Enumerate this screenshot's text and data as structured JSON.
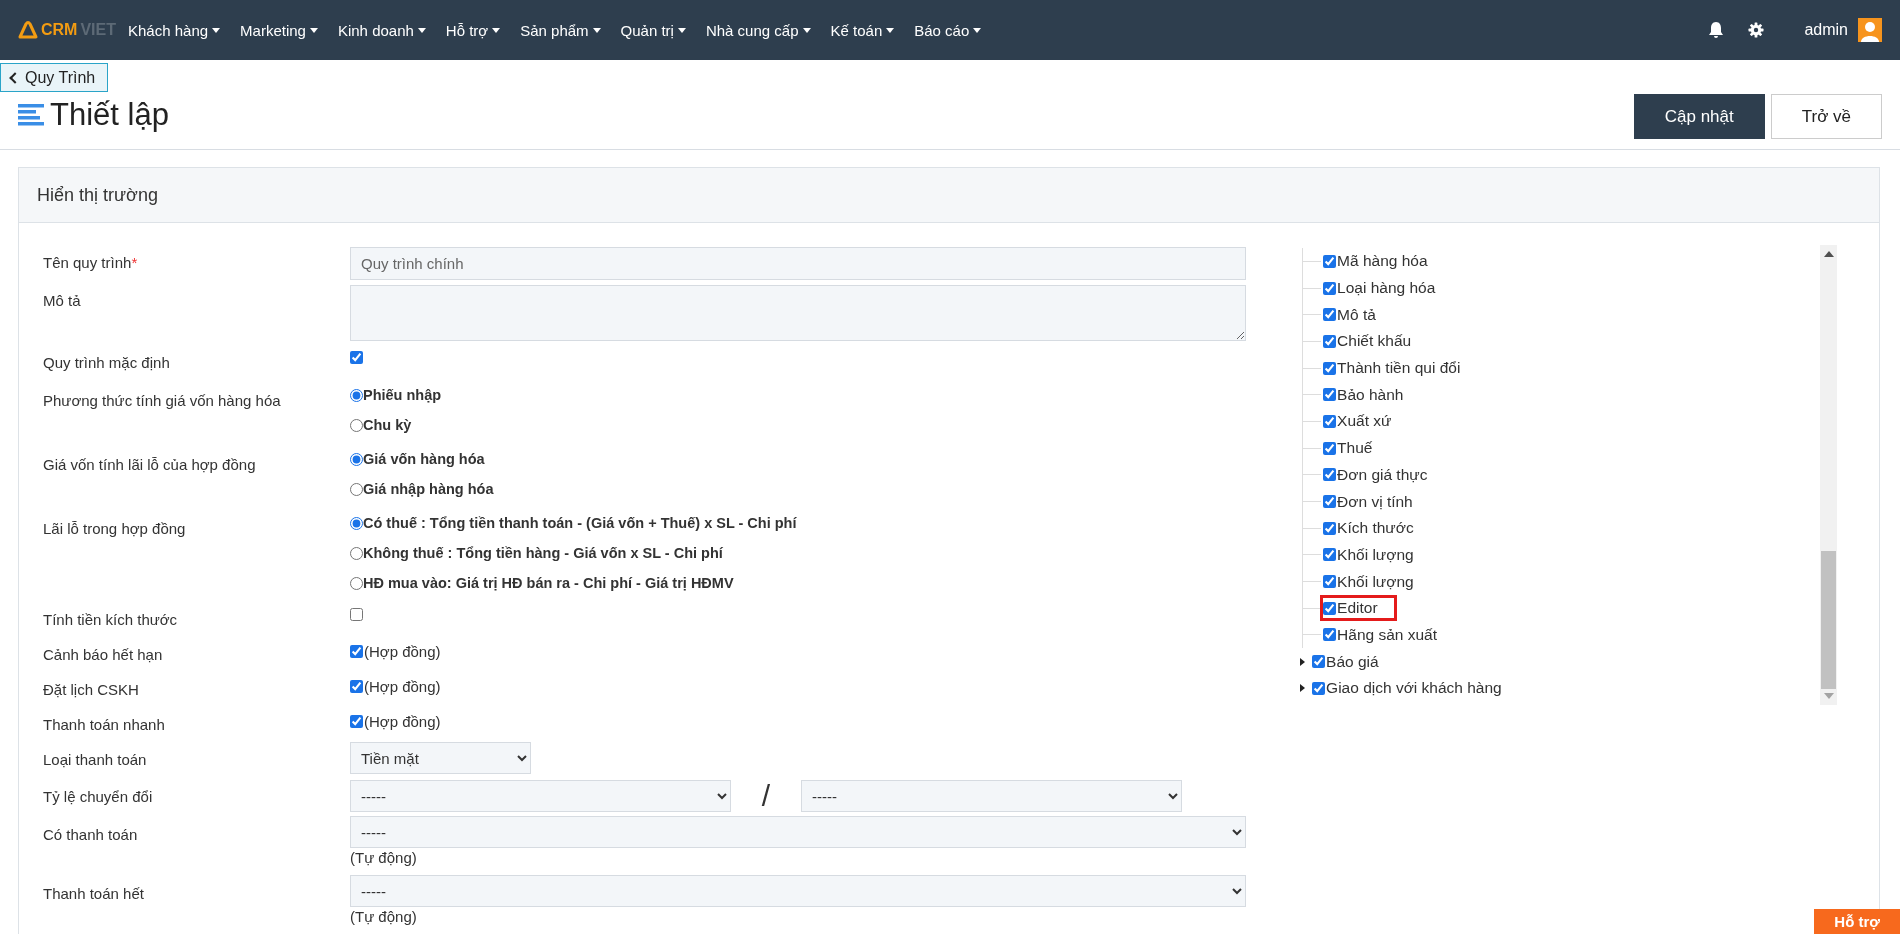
{
  "nav": {
    "logo_primary": "CRM",
    "logo_secondary": "VIET",
    "menu": [
      {
        "label": "Khách hàng"
      },
      {
        "label": "Marketing"
      },
      {
        "label": "Kinh doanh"
      },
      {
        "label": "Hỗ trợ"
      },
      {
        "label": "Sản phẩm"
      },
      {
        "label": "Quản trị"
      },
      {
        "label": "Nhà cung cấp"
      },
      {
        "label": "Kế toán"
      },
      {
        "label": "Báo cáo"
      }
    ],
    "user": "admin"
  },
  "breadcrumb": "Quy Trình",
  "page_title": "Thiết lập",
  "actions": [
    {
      "label": "Cập nhật",
      "kind": "primary"
    },
    {
      "label": "Trở về",
      "kind": "default"
    }
  ],
  "panel": {
    "title": "Hiển thị trường"
  },
  "form": [
    {
      "kind": "text",
      "label": "Tên quy trình",
      "required_mark": "*",
      "value": "Quy trình chính"
    },
    {
      "kind": "textarea",
      "label": "Mô tả"
    },
    {
      "kind": "checkbox",
      "label": "Quy trình mặc định",
      "checked": true
    },
    {
      "kind": "radio",
      "label": "Phương thức tính giá vốn hàng hóa",
      "options": [
        {
          "label": "Phiếu nhập",
          "selected": true
        },
        {
          "label": "Chu kỳ",
          "selected": false
        }
      ]
    },
    {
      "kind": "radio",
      "label": "Giá vốn tính lãi lỗ của hợp đồng",
      "options": [
        {
          "label": "Giá vốn hàng hóa",
          "selected": true
        },
        {
          "label": "Giá nhập hàng hóa",
          "selected": false
        }
      ]
    },
    {
      "kind": "radio",
      "label": "Lãi lỗ trong hợp đồng",
      "options": [
        {
          "label": "Có thuế : Tổng tiền thanh toán - (Giá vốn + Thuế) x SL - Chi phí",
          "selected": true
        },
        {
          "label": "Không thuế : Tổng tiền hàng - Giá vốn x SL - Chi phí",
          "selected": false
        },
        {
          "label": "HĐ mua vào: Giá trị HĐ bán ra - Chi phí - Giá trị HĐMV",
          "selected": false
        }
      ]
    },
    {
      "kind": "checkbox",
      "label": "Tính tiền kích thước",
      "checked": false
    },
    {
      "kind": "checkbox",
      "label": "Cảnh báo hết hạn",
      "checked": true,
      "note": "(Hợp đồng)"
    },
    {
      "kind": "checkbox",
      "label": "Đặt lịch CSKH",
      "checked": true,
      "note": "(Hợp đồng)"
    },
    {
      "kind": "checkbox",
      "label": "Thanh toán nhanh",
      "checked": true,
      "note": "(Hợp đồng)"
    },
    {
      "kind": "dropdown",
      "label": "Loại thanh toán",
      "value": "Tiền mặt"
    },
    {
      "kind": "ratio",
      "label": "Tỷ lệ chuyển đổi",
      "values": [
        "-----",
        "-----"
      ],
      "separator": "/"
    },
    {
      "kind": "select",
      "label": "Có thanh toán",
      "value": "-----",
      "hint": "(Tự động)"
    },
    {
      "kind": "select",
      "label": "Thanh toán hết",
      "value": "-----",
      "hint": "(Tự động)"
    }
  ],
  "field_tree": {
    "nested_items": [
      {
        "label": "Mã hàng hóa",
        "checked": true,
        "highlighted": false
      },
      {
        "label": "Loại hàng hóa",
        "checked": true,
        "highlighted": false
      },
      {
        "label": "Mô tả",
        "checked": true,
        "highlighted": false
      },
      {
        "label": "Chiết khấu",
        "checked": true,
        "highlighted": false
      },
      {
        "label": "Thành tiền qui đổi",
        "checked": true,
        "highlighted": false
      },
      {
        "label": "Bảo hành",
        "checked": true,
        "highlighted": false
      },
      {
        "label": "Xuất xứ",
        "checked": true,
        "highlighted": false
      },
      {
        "label": "Thuế",
        "checked": true,
        "highlighted": false
      },
      {
        "label": "Đơn giá thực",
        "checked": true,
        "highlighted": false
      },
      {
        "label": "Đơn vị tính",
        "checked": true,
        "highlighted": false
      },
      {
        "label": "Kích thước",
        "checked": true,
        "highlighted": false
      },
      {
        "label": "Khối lượng",
        "checked": true,
        "highlighted": false
      },
      {
        "label": "Khối lượng",
        "checked": true,
        "highlighted": false
      },
      {
        "label": "Editor",
        "checked": true,
        "highlighted": true
      },
      {
        "label": "Hãng sản xuất",
        "checked": true,
        "highlighted": false
      }
    ],
    "items": [
      {
        "label": "Báo giá",
        "checked": true,
        "expanded": false
      },
      {
        "label": "Giao dịch với khách hàng",
        "checked": true,
        "expanded": false
      }
    ]
  },
  "help_button": "Hỗ trợ"
}
